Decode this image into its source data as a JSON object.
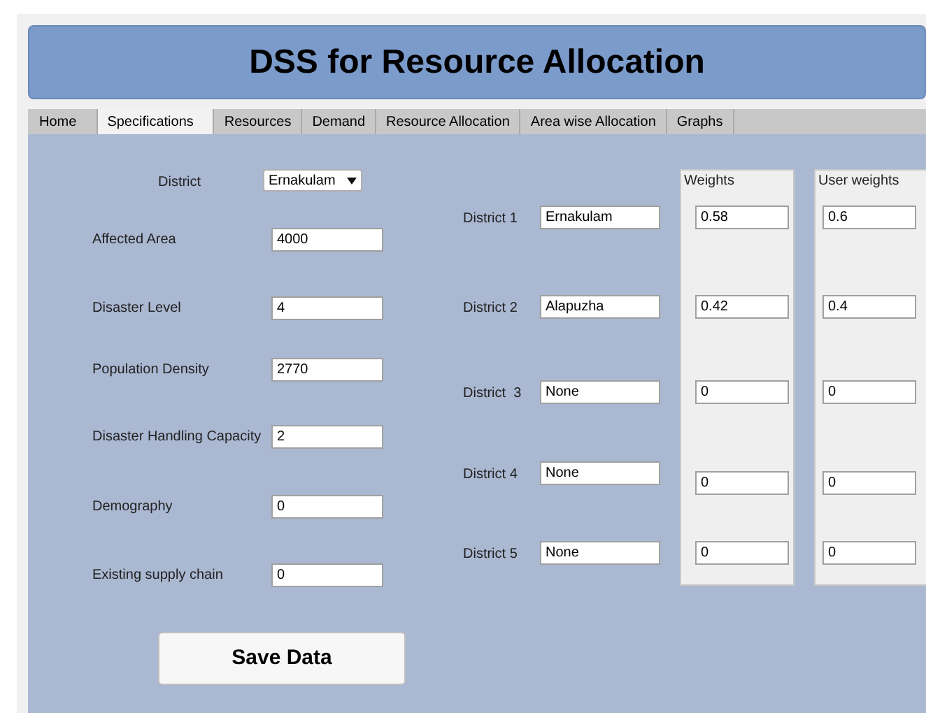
{
  "window": {
    "title": "DSS for Resource Allocation"
  },
  "tabs": [
    {
      "label": "Home",
      "selected": false
    },
    {
      "label": "Specifications",
      "selected": true
    },
    {
      "label": "Resources",
      "selected": false
    },
    {
      "label": "Demand",
      "selected": false
    },
    {
      "label": "Resource Allocation",
      "selected": false
    },
    {
      "label": "Area wise Allocation",
      "selected": false
    },
    {
      "label": "Graphs",
      "selected": false
    }
  ],
  "district_select": {
    "label": "District",
    "value": "Ernakulam"
  },
  "fields": [
    {
      "label": "Affected Area",
      "value": "4000"
    },
    {
      "label": "Disaster Level",
      "value": "4"
    },
    {
      "label": "Population Density",
      "value": "2770"
    },
    {
      "label": "Disaster Handling Capacity",
      "value": "2"
    },
    {
      "label": "Demography",
      "value": "0"
    },
    {
      "label": "Existing supply chain",
      "value": "0"
    }
  ],
  "weights_panel": {
    "title": "Weights"
  },
  "user_weights_panel": {
    "title": "User weights"
  },
  "districts": [
    {
      "label": "District 1",
      "name": "Ernakulam",
      "weight": "0.58",
      "user_weight": "0.6"
    },
    {
      "label": "District 2",
      "name": "Alapuzha",
      "weight": "0.42",
      "user_weight": "0.4"
    },
    {
      "label": "District  3",
      "name": "None",
      "weight": "0",
      "user_weight": "0"
    },
    {
      "label": "District 4",
      "name": "None",
      "weight": "0",
      "user_weight": "0"
    },
    {
      "label": "District 5",
      "name": "None",
      "weight": "0",
      "user_weight": "0"
    }
  ],
  "save_button": {
    "label": "Save Data"
  }
}
